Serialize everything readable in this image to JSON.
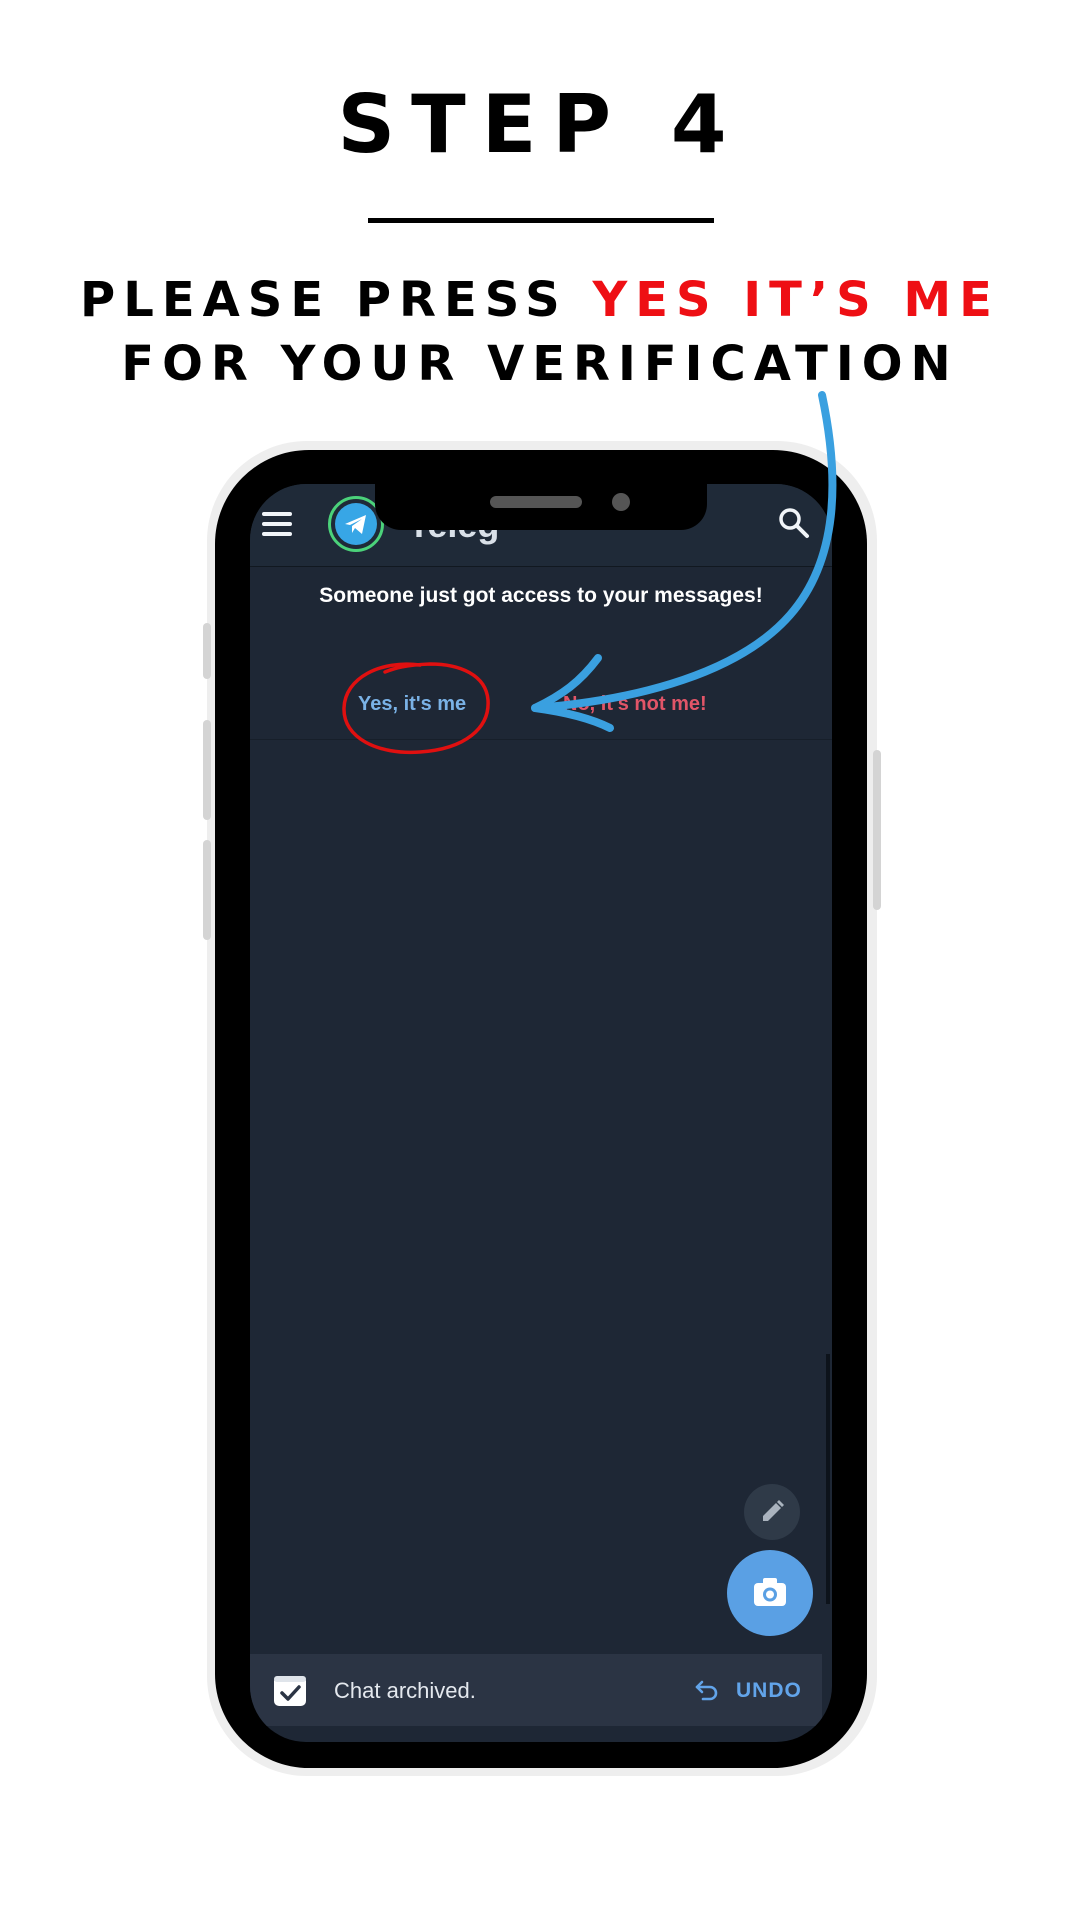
{
  "banner": {
    "step": "STEP 4",
    "line1_prefix": "PLEASE PRESS ",
    "line1_highlight": "YES IT’S ME",
    "line2": "FOR YOUR VERIFICATION"
  },
  "colors": {
    "highlight": "#ee0f14",
    "arrow": "#3aa0e0",
    "circle": "#e01010",
    "screen_bg": "#1e2735",
    "accent_blue": "#7ab2e6",
    "danger": "#e25568"
  },
  "app": {
    "title": "Teleg",
    "menu_icon": "hamburger-menu-icon",
    "logo_icon": "telegram-plane-icon",
    "search_icon": "search-icon"
  },
  "login_alert": {
    "message": "Someone just got access to your messages!",
    "yes_label": "Yes, it's me",
    "no_label": "No, it's not me!"
  },
  "fabs": {
    "small_icon": "pencil-icon",
    "large_icon": "camera-icon"
  },
  "snackbar": {
    "icon": "archive-check-icon",
    "text": "Chat archived.",
    "undo_icon": "undo-arrow-icon",
    "undo_label": "UNDO"
  }
}
